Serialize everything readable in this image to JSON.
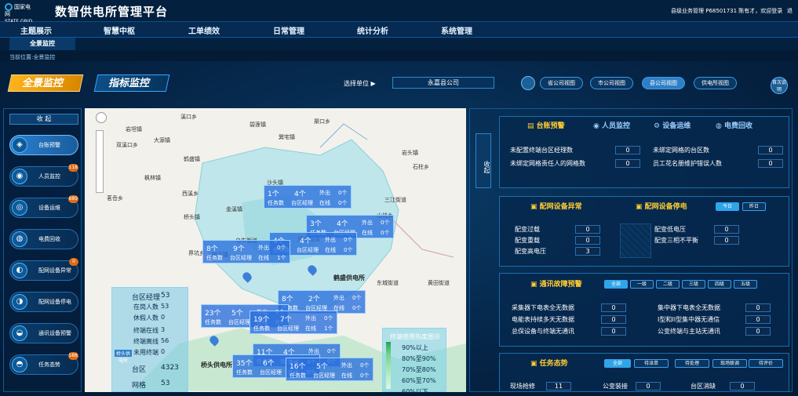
{
  "header": {
    "logo_line1": "国家电网",
    "logo_line2": "STATE GRID",
    "title": "数智供电所管理平台",
    "user_info": "县级业务管理  P68501731  陈有才，欢迎登录",
    "exit_label": "退"
  },
  "nav": {
    "items": [
      "主题展示",
      "智慧中枢",
      "工单绩效",
      "日常管理",
      "统计分析",
      "系统管理"
    ]
  },
  "subnav": {
    "active": "全景监控"
  },
  "breadcrumb": "当前位置:全景监控",
  "tabs": {
    "overview": "全景监控",
    "indicator": "指标监控"
  },
  "unit_select": {
    "label": "选择单位",
    "value": "永嘉县公司"
  },
  "views": [
    "省公司视图",
    "市公司视图",
    "县公司视图",
    "供电所视图"
  ],
  "active_view": "县公司视图",
  "help": "首次说明",
  "sidebar": {
    "collapse": "收 起",
    "items": [
      {
        "label": "台账预警",
        "badge": "",
        "icon": "◈"
      },
      {
        "label": "人员监控",
        "badge": "118",
        "icon": "◉"
      },
      {
        "label": "设备运维",
        "badge": "889",
        "icon": "◎"
      },
      {
        "label": "电费回收",
        "badge": "",
        "icon": "◍"
      },
      {
        "label": "配网设备异常",
        "badge": "0",
        "icon": "◐"
      },
      {
        "label": "配网设备停电",
        "badge": "",
        "icon": "◑"
      },
      {
        "label": "通讯设备预警",
        "badge": "",
        "icon": "◒"
      },
      {
        "label": "任务态势",
        "badge": "588",
        "icon": "◓"
      }
    ]
  },
  "map": {
    "towns": [
      "岩坦镇",
      "双溪口乡",
      "大源镇",
      "溪口乡",
      "鹤盛镇",
      "碧莲镇",
      "巽宅镇",
      "岩头镇",
      "金溪镇",
      "桥头镇",
      "乌牛街道",
      "东城街道",
      "黄田街道",
      "三江街道",
      "瓯北街道",
      "枫林镇",
      "西溪乡",
      "沙头镇",
      "桥下镇",
      "界坑乡",
      "茗岙乡",
      "渠口乡",
      "石柱乡",
      "山坑乡"
    ],
    "station_label": "鹤盛供电所",
    "station_label2": "桥头供电所",
    "popups": [
      {
        "a": "1个",
        "b": "4个",
        "c": "外出",
        "d": "0个",
        "e": "任务数",
        "f": "台区经理",
        "g": "在线",
        "h": "0个"
      },
      {
        "a": "3个",
        "b": "4个",
        "c": "外出",
        "d": "0个",
        "e": "任务数",
        "f": "台区经理",
        "g": "在线",
        "h": "0个"
      },
      {
        "a": "4个",
        "b": "4个",
        "c": "外出",
        "d": "0个",
        "e": "任务数",
        "f": "台区经理",
        "g": "在线",
        "h": "0个"
      },
      {
        "a": "8个",
        "b": "9个",
        "c": "外出",
        "d": "0个",
        "e": "任务数",
        "f": "台区经理",
        "g": "在线",
        "h": "1个"
      },
      {
        "a": "8个",
        "b": "2个",
        "c": "外出",
        "d": "0个",
        "e": "任务数",
        "f": "台区经理",
        "g": "在线",
        "h": "0个"
      },
      {
        "a": "23个",
        "b": "5个",
        "c": "外出",
        "d": "0个",
        "e": "任务数",
        "f": "台区经理",
        "g": "在线",
        "h": "0个"
      },
      {
        "a": "19个",
        "b": "7个",
        "c": "外出",
        "d": "0个",
        "e": "任务数",
        "f": "台区经理",
        "g": "在线",
        "h": "1个"
      },
      {
        "a": "11个",
        "b": "4个",
        "c": "外出",
        "d": "0个",
        "e": "任务数",
        "f": "台区经理",
        "g": "在线",
        "h": "0个"
      },
      {
        "a": "35个",
        "b": "6个",
        "c": "外出",
        "d": "0个",
        "e": "任务数",
        "f": "台区经理",
        "g": "在线",
        "h": "0个"
      },
      {
        "a": "16个",
        "b": "5个",
        "c": "外出",
        "d": "0个",
        "e": "任务数",
        "f": "台区经理",
        "g": "在线",
        "h": "0个"
      }
    ],
    "info": {
      "rows": [
        {
          "label": "台区经理",
          "value": "53"
        },
        {
          "label": "在岗人数",
          "value": "53"
        },
        {
          "label": "休假人数",
          "value": "0"
        },
        {
          "label": "终端在线",
          "value": "3"
        },
        {
          "label": "终端离线",
          "value": "56"
        },
        {
          "label": "未用终端",
          "value": "0"
        },
        {
          "label": "台区",
          "value": "4323"
        },
        {
          "label": "网格",
          "value": "53"
        }
      ],
      "tag": "桥头供电所"
    },
    "legend": {
      "title": "终端使用热度图示",
      "items": [
        "90%以上",
        "80%至90%",
        "70%至80%",
        "60%至70%",
        "60%以下"
      ]
    }
  },
  "right": {
    "collapse": "收起",
    "tabs": [
      "台账预警",
      "人员监控",
      "设备运维",
      "电费回收"
    ],
    "ledger": [
      {
        "label": "未配置终端台区经理数",
        "value": "0"
      },
      {
        "label": "未绑定网格的台区数",
        "value": "0"
      },
      {
        "label": "未绑定网格责任人的网格数",
        "value": "0"
      },
      {
        "label": "员工花名册维护错误人数",
        "value": "0"
      }
    ],
    "abnormal": {
      "title": "配网设备异常",
      "rows": [
        {
          "label": "配变过载",
          "value": "0"
        },
        {
          "label": "配变重载",
          "value": "0"
        },
        {
          "label": "配变高电压",
          "value": "3"
        }
      ]
    },
    "outage": {
      "title": "配网设备停电",
      "today": "今日",
      "yesterday": "昨日",
      "rows": [
        {
          "label": "配变低电压",
          "value": "0"
        },
        {
          "label": "配变三相不平衡",
          "value": "0"
        }
      ]
    },
    "comm": {
      "title": "通讯故障预警",
      "levels": [
        "全部",
        "一级",
        "二级",
        "三级",
        "四级",
        "五级"
      ],
      "rows": [
        {
          "label": "采集器下电表全无数据",
          "value": "0"
        },
        {
          "label": "集中器下电表全无数据",
          "value": "0"
        },
        {
          "label": "电能表持续多天无数据",
          "value": "0"
        },
        {
          "label": "I型和II型集中器无通信",
          "value": "0"
        },
        {
          "label": "总保设备与终端无通讯",
          "value": "0"
        },
        {
          "label": "公变终端与主站无通讯",
          "value": "0"
        }
      ]
    },
    "task": {
      "title": "任务态势",
      "tabs": [
        "全部",
        "待派单",
        "待处理",
        "现场联调",
        "待评价"
      ],
      "rows": [
        {
          "label": "现场抢修",
          "value": "11"
        },
        {
          "label": "公变装接",
          "value": "0"
        },
        {
          "label": "台区消缺",
          "value": "0"
        }
      ]
    }
  },
  "colors": {
    "accent": "#2da5e8",
    "gold": "#ffb31a",
    "panel": "#06284e"
  }
}
